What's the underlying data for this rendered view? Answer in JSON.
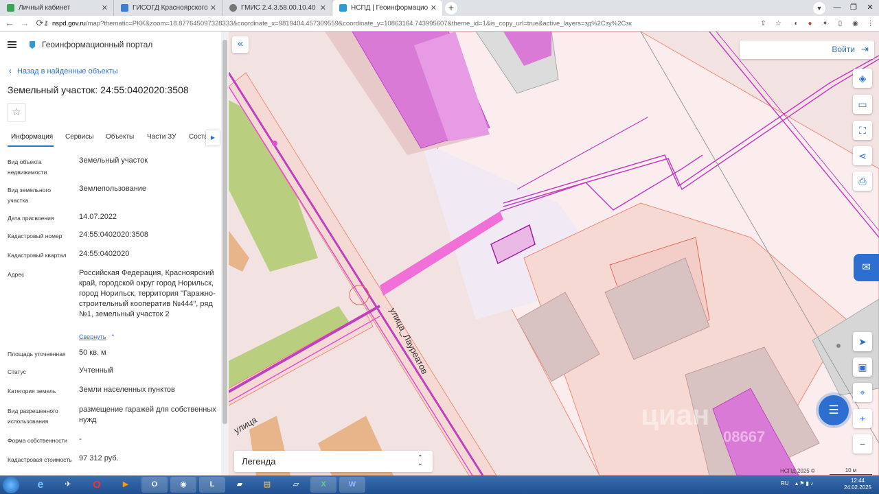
{
  "browser": {
    "tabs": [
      {
        "title": "Личный кабинет",
        "active": false
      },
      {
        "title": "ГИСОГД Красноярского края",
        "active": false
      },
      {
        "title": "ГМИС 2.4.3.58.00.10.40",
        "active": false
      },
      {
        "title": "НСПД | Геоинформационный п",
        "active": true
      }
    ],
    "url_host": "nspd.gov.ru",
    "url_path": "/map?thematic=PKK&zoom=18.877645097328333&coordinate_x=9819404.457309559&coordinate_y=10863164.743995607&theme_id=1&is_copy_url=true&active_layers=зд%2Cзу%2Cзк"
  },
  "panel": {
    "portal_title": "Геоинформационный портал",
    "back_label": "Назад в найденные объекты",
    "object_title": "Земельный участок: 24:55:0402020:3508",
    "tabs": [
      "Информация",
      "Сервисы",
      "Объекты",
      "Части ЗУ",
      "Соста"
    ],
    "properties": [
      {
        "label": "Вид объекта недвижимости",
        "value": "Земельный участок"
      },
      {
        "label": "Вид земельного участка",
        "value": "Землепользование"
      },
      {
        "label": "Дата присвоения",
        "value": "14.07.2022"
      },
      {
        "label": "Кадастровый номер",
        "value": "24:55:0402020:3508"
      },
      {
        "label": "Кадастровый квартал",
        "value": "24:55:0402020"
      },
      {
        "label": "Адрес",
        "value": "Российская Федерация, Красноярский край, городской округ город Норильск, город Норильск, территория \"Гаражно-строительный кооператив №444\", ряд №1, земельный участок 2"
      },
      {
        "label": "Площадь уточненная",
        "value": "50 кв. м"
      },
      {
        "label": "Статус",
        "value": "Учтенный"
      },
      {
        "label": "Категория земель",
        "value": "Земли населенных пунктов"
      },
      {
        "label": "Вид разрешенного использования",
        "value": "размещение гаражей для собственных нужд"
      },
      {
        "label": "Форма собственности",
        "value": "-"
      },
      {
        "label": "Кадастровая стоимость",
        "value": "97 312 руб."
      }
    ],
    "collapse_label": "Свернуть"
  },
  "map": {
    "login_label": "Войти",
    "legend_label": "Легенда",
    "street_label_1": "улица_Лауреатов",
    "street_label_2": "улица",
    "copyright": "НСПД 2025 ©",
    "scale_label": "10 м",
    "watermark": "циан",
    "watermark_id": "08667"
  },
  "taskbar": {
    "lang": "RU",
    "time": "12:44",
    "date": "24.02.2025"
  },
  "colors": {
    "accent": "#2c6fd0",
    "parcel_fill": "#f3d5d5",
    "building": "#d97bd6",
    "green": "#b9cf7f"
  }
}
